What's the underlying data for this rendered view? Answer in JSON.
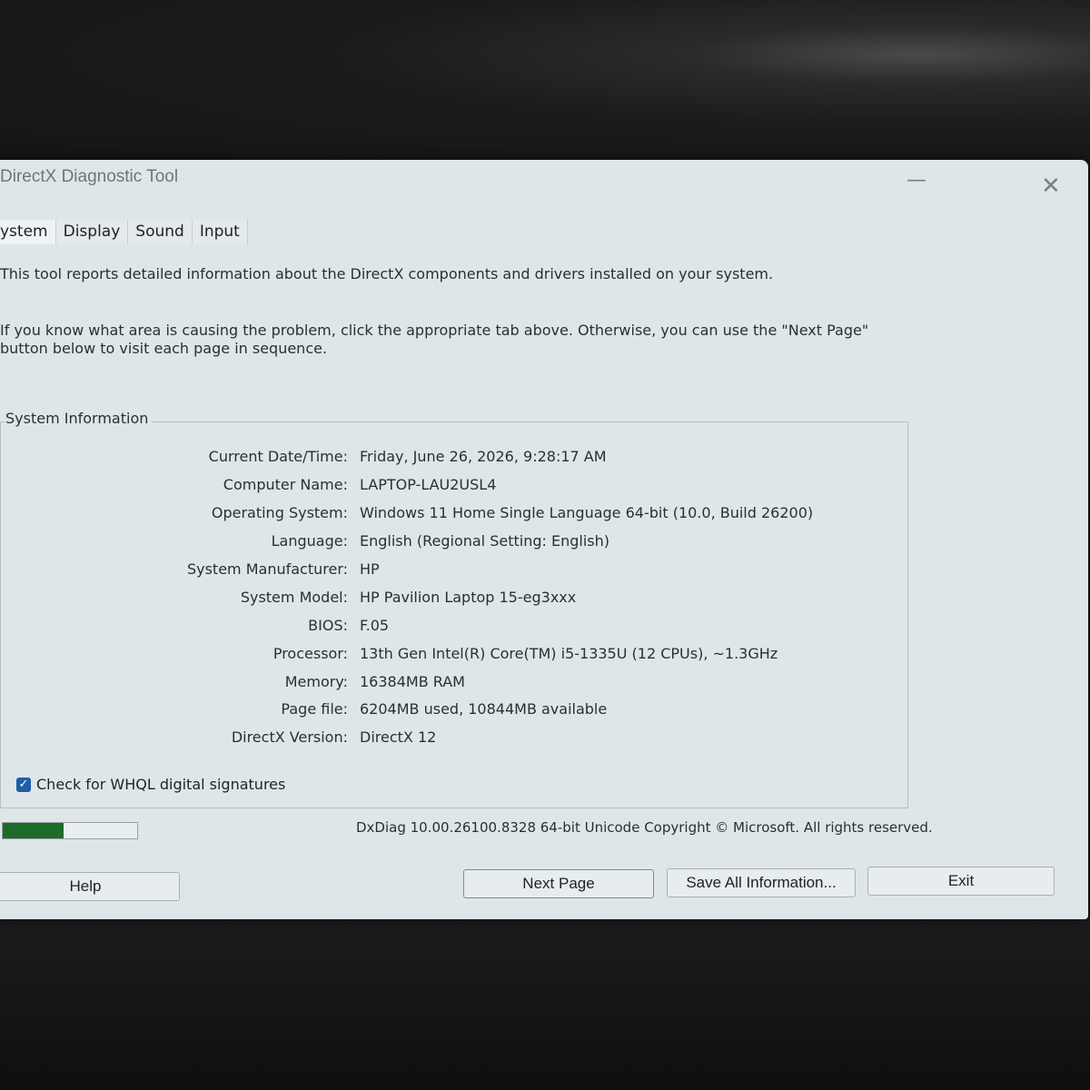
{
  "window": {
    "title": "DirectX Diagnostic Tool",
    "minimize_glyph": "—",
    "close_glyph": "✕"
  },
  "tabs": [
    {
      "label": "ystem",
      "active": true
    },
    {
      "label": "Display",
      "active": false
    },
    {
      "label": "Sound",
      "active": false
    },
    {
      "label": "Input",
      "active": false
    }
  ],
  "description": {
    "line1": "This tool reports detailed information about the DirectX components and drivers installed on your system.",
    "line2": "If you know what area is causing the problem, click the appropriate tab above.  Otherwise, you can use the \"Next Page\" button below to visit each page in sequence."
  },
  "system_info": {
    "group_label": "System Information",
    "rows": [
      {
        "label": "Current Date/Time:",
        "value": "Friday, June 26, 2026, 9:28:17 AM"
      },
      {
        "label": "Computer Name:",
        "value": "LAPTOP-LAU2USL4"
      },
      {
        "label": "Operating System:",
        "value": "Windows 11 Home Single Language 64-bit (10.0, Build 26200)"
      },
      {
        "label": "Language:",
        "value": "English (Regional Setting: English)"
      },
      {
        "label": "System Manufacturer:",
        "value": "HP"
      },
      {
        "label": "System Model:",
        "value": "HP Pavilion Laptop 15-eg3xxx"
      },
      {
        "label": "BIOS:",
        "value": "F.05"
      },
      {
        "label": "Processor:",
        "value": "13th Gen Intel(R) Core(TM) i5-1335U (12 CPUs), ~1.3GHz"
      },
      {
        "label": "Memory:",
        "value": "16384MB RAM"
      },
      {
        "label": "Page file:",
        "value": "6204MB used, 10844MB available"
      },
      {
        "label": "DirectX Version:",
        "value": "DirectX 12"
      }
    ]
  },
  "whql": {
    "label": "Check for WHQL digital signatures",
    "checked": true,
    "check_glyph": "✓"
  },
  "progress": {
    "fraction": 0.45,
    "color": "#1d6b28"
  },
  "footer": {
    "version_text": "DxDiag 10.00.26100.8328 64-bit Unicode  Copyright © Microsoft. All rights reserved."
  },
  "buttons": {
    "help": "Help",
    "next_page": "Next Page",
    "save_all": "Save All Information...",
    "exit": "Exit"
  }
}
